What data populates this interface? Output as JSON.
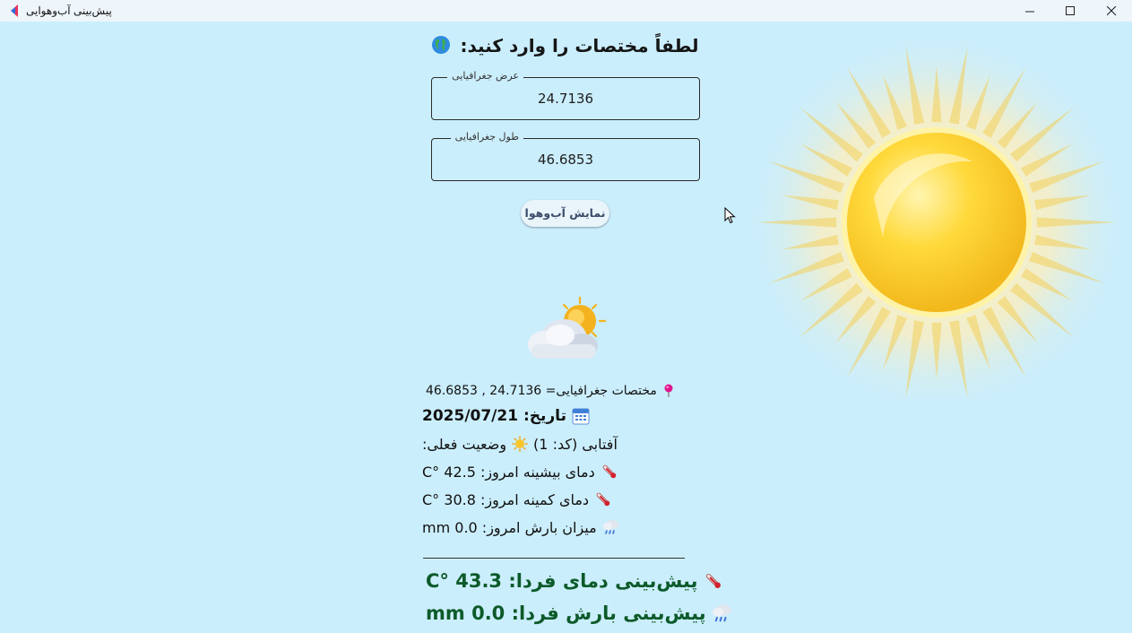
{
  "window": {
    "title": "پیش‌بینی آب‌وهوایی",
    "controls": [
      "minimize",
      "maximize",
      "close"
    ]
  },
  "form": {
    "title": "لطفاً مختصات را وارد کنید:",
    "latitude": {
      "label": "عرض جغرافیایی",
      "value": "24.7136"
    },
    "longitude": {
      "label": "طول جغرافیایی",
      "value": "46.6853"
    },
    "submit_label": "نمایش آب‌وهوا"
  },
  "results": {
    "coords_line": "مختصات جغرافیایی= 24.7136 , 46.6853",
    "date_line": "تاریخ: 2025/07/21",
    "condition_prefix": "وضعیت فعلی:",
    "condition_text": "آفتابی (کد: 1)",
    "max_temp_line": "دمای بیشینه امروز: 42.5 °C",
    "min_temp_line": "دمای کمینه امروز: 30.8 °C",
    "precip_line": "میزان بارش امروز: 0.0 mm",
    "separator": "_____________________________________",
    "tomorrow_temp_line": "پیش‌بینی دمای فردا: 43.3 °C",
    "tomorrow_precip_line": "پیش‌بینی بارش فردا: 0.0 mm"
  },
  "icons": {
    "globe": "globe-icon",
    "pin": "pin-icon",
    "calendar": "calendar-icon",
    "sun": "sun-icon",
    "thermometer": "thermometer-icon",
    "rain": "rain-cloud-icon"
  },
  "colors": {
    "background": "#cbeefc",
    "prediction_text": "#0c5a2a",
    "titlebar": "#eef5fb"
  }
}
